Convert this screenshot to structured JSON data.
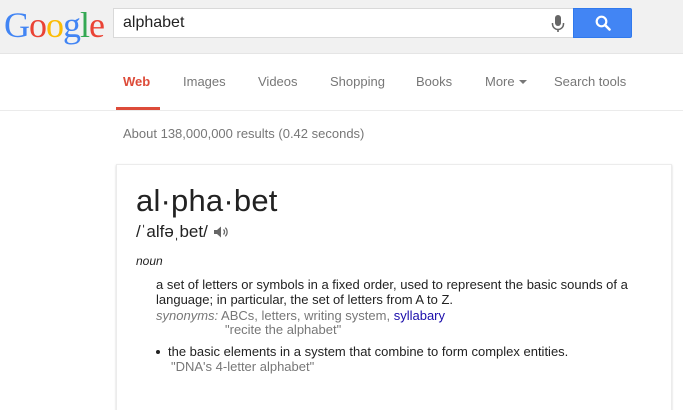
{
  "header": {
    "logo": [
      "G",
      "o",
      "o",
      "g",
      "l",
      "e"
    ],
    "logo_colors": [
      "#4285f4",
      "#ea4335",
      "#fbbc05",
      "#4285f4",
      "#34a853",
      "#ea4335"
    ],
    "search_query": "alphabet",
    "mic_icon": "microphone-icon",
    "search_button_icon": "search-icon"
  },
  "tabs": [
    {
      "label": "Web",
      "active": true
    },
    {
      "label": "Images"
    },
    {
      "label": "Videos"
    },
    {
      "label": "Shopping"
    },
    {
      "label": "Books"
    },
    {
      "label": "More"
    },
    {
      "label": "Search tools"
    }
  ],
  "result_stats": "About 138,000,000 results (0.42 seconds)",
  "definition": {
    "word": "al·pha·bet",
    "pronunciation": "/ˈalfəˌbet/",
    "speaker_icon": "speaker-icon",
    "part_of_speech": "noun",
    "senses": [
      {
        "text": "a set of letters or symbols in a fixed order, used to represent the basic sounds of a language; in particular, the set of letters from A to Z.",
        "synonyms_label": "synonyms:",
        "synonyms": "ABCs, letters, writing system,",
        "synonym_link": "syllabary",
        "example": "\"recite the alphabet\""
      },
      {
        "text": "the basic elements in a system that combine to form complex entities.",
        "example": "\"DNA's 4-letter alphabet\""
      }
    ]
  },
  "colors": {
    "active_tab": "#dd4b39",
    "search_button": "#4285f4",
    "link": "#1a0dab",
    "muted": "#777777"
  }
}
